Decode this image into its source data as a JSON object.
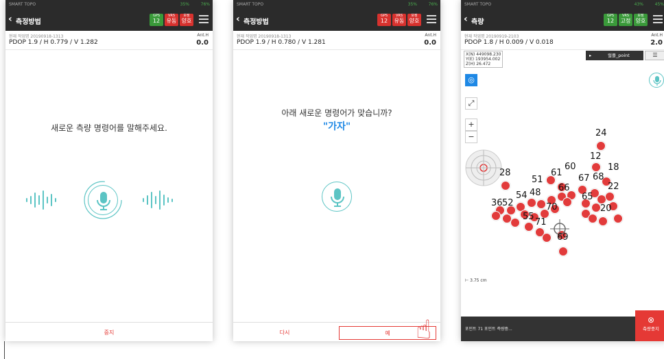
{
  "colors": {
    "accent": "#e53935",
    "mic": "#5bc4c4",
    "topbar": "#2b2b2b",
    "gps_green": "#3a9a3a",
    "status_red": "#d7322e",
    "point_red": "#e23b3b"
  },
  "screen1": {
    "status": {
      "app": "SMART TOPO",
      "signal": "35%",
      "battery": "76%"
    },
    "title": "측정방법",
    "badges": [
      {
        "label": "GPS",
        "value": "12"
      },
      {
        "label": "VRS",
        "value": "유동"
      },
      {
        "label": "보정",
        "value": "양호"
      }
    ],
    "info_label": "현재 작업명 20190918-1313",
    "info_main": "PDOP 1.9 / H 0.779 / V 1.282",
    "ant_label": "Ant.H",
    "ant_value": "0.0",
    "prompt": "새로운 측량 명령어를 말해주세요.",
    "mic_icon": "microphone-icon",
    "bottom_button": "중지"
  },
  "screen2": {
    "status": {
      "app": "SMART TOPO",
      "signal": "35%",
      "battery": "76%"
    },
    "title": "측정방법",
    "badges": [
      {
        "label": "GPS",
        "value": "12"
      },
      {
        "label": "VRS",
        "value": "유동"
      },
      {
        "label": "보정",
        "value": "양호"
      }
    ],
    "info_label": "현재 작업명 20190918-1313",
    "info_main": "PDOP 1.9 / H 0.780 / V 1.281",
    "ant_label": "Ant.H",
    "ant_value": "0.0",
    "question": "아래 새로운 명령어가 맞습니까?",
    "command": "\"가자\"",
    "btn_retry": "다시",
    "btn_yes": "예"
  },
  "screen3": {
    "status": {
      "app": "SMART TOPO",
      "signal": "43%",
      "battery": "45%"
    },
    "title": "측량",
    "badges": [
      {
        "label": "GPS",
        "value": "12"
      },
      {
        "label": "VRS",
        "value": "고정"
      },
      {
        "label": "보정",
        "value": "양호"
      }
    ],
    "info_label": "현재 작업명 20190919-2103",
    "info_main": "PDOP 1.8 / H 0.009 / V 0.018",
    "ant_label": "Ant.H",
    "ant_value": "2.0",
    "coords": {
      "x": "X(N) 449098.230",
      "y": "Y(E) 193954.002",
      "z": "Z(H) 26.472"
    },
    "point_label": "",
    "point_value": "럴플_point",
    "scale": "3.75 cm",
    "status_text": "포인트 71 포인트 측량중...",
    "stop_label": "측량중지",
    "point_labels": [
      "24",
      "12",
      "18",
      "28",
      "51",
      "61",
      "60",
      "67",
      "68",
      "22",
      "66",
      "54",
      "48",
      "36",
      "52",
      "70",
      "65",
      "20",
      "55",
      "71",
      "69"
    ]
  }
}
